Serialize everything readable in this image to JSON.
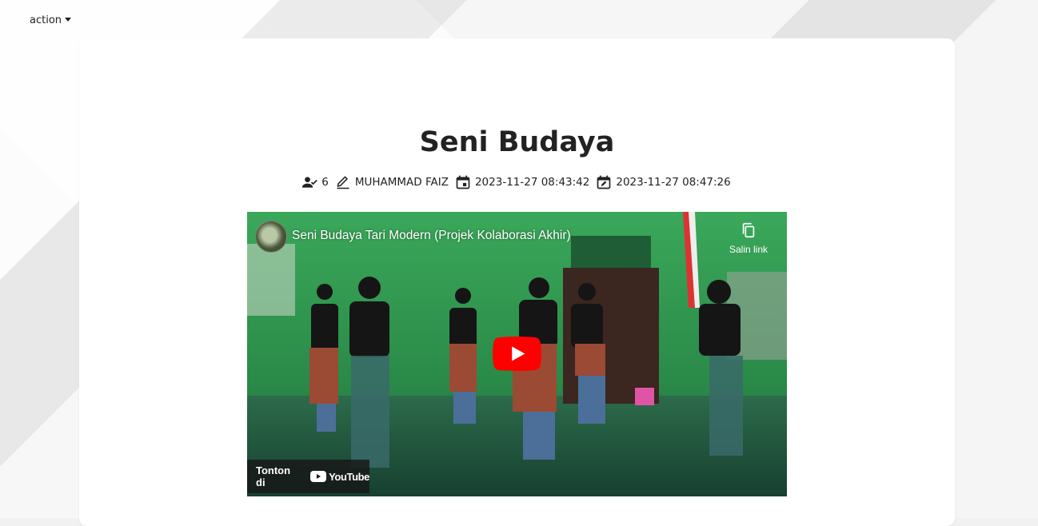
{
  "topbar": {
    "action_label": "action"
  },
  "post": {
    "title": "Seni Budaya",
    "views": "6",
    "author": "MUHAMMAD FAIZ",
    "created": "2023-11-27 08:43:42",
    "updated": "2023-11-27 08:47:26"
  },
  "video": {
    "title": "Seni Budaya Tari Modern (Projek Kolaborasi Akhir)",
    "copy_link_label": "Salin link",
    "watch_on_label": "Tonton di",
    "youtube_label": "YouTube"
  },
  "icons": {
    "views": "person-check-icon",
    "author": "pencil-icon",
    "created": "calendar-icon",
    "updated": "calendar-edit-icon",
    "copy": "copy-icon",
    "play": "play-icon"
  },
  "colors": {
    "youtube_red": "#ff0000",
    "video_bg": "#1f6e3e"
  }
}
